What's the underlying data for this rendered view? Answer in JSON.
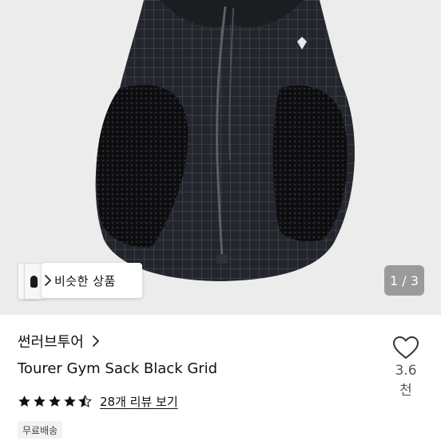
{
  "gallery": {
    "similar_label": "비슷한 상품",
    "counter": "1 / 3"
  },
  "product": {
    "store_name": "썬러브투어",
    "title": "Tourer Gym Sack Black Grid",
    "like_count": "3.6천",
    "rating": 4.5,
    "review_link": "28개 리뷰 보기",
    "badge": "무료배송"
  },
  "icons": {
    "store_arrow": "chevron-right-icon",
    "like": "heart-outline-icon",
    "similar_arrow": "chevron-right-icon"
  },
  "colors": {
    "counter_bg": "#9a9a9a",
    "star": "#111111"
  }
}
